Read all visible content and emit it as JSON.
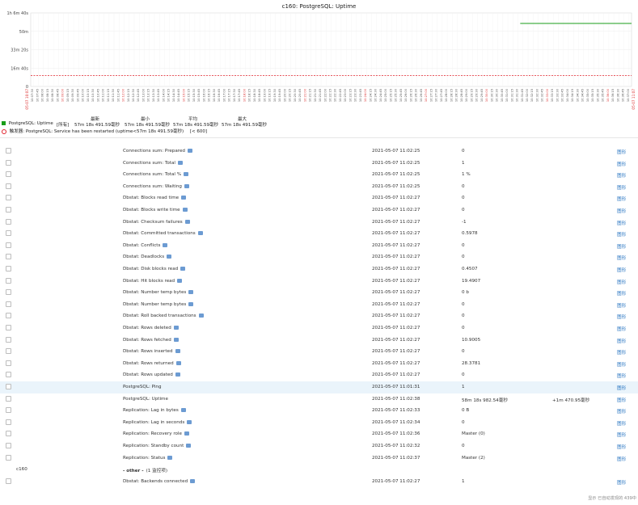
{
  "chart_data": {
    "type": "line",
    "title": "c160: PostgreSQL: Uptime",
    "y_ticks": [
      "1h 6m 40s",
      "50m",
      "33m 20s",
      "16m 40s",
      "0"
    ],
    "x_ticks": [
      "10:07:30",
      "10:07:45",
      "10:08:00",
      "10:08:15",
      "10:08:30",
      "10:08:45",
      "10:09:00",
      "10:09:15",
      "10:09:30",
      "10:09:45",
      "10:10:00",
      "10:10:15",
      "10:10:30",
      "10:10:45",
      "10:11:00",
      "10:11:15",
      "10:11:30",
      "10:11:45",
      "10:12:00",
      "10:12:15",
      "10:12:30",
      "10:12:45",
      "10:13:00",
      "10:13:15",
      "10:13:30",
      "10:13:45",
      "10:14:00",
      "10:14:15",
      "10:14:30",
      "10:14:45",
      "10:15:00",
      "10:15:15",
      "10:15:30",
      "10:15:45",
      "10:16:00",
      "10:16:15",
      "10:16:30",
      "10:16:45",
      "10:17:00",
      "10:17:15",
      "10:17:30",
      "10:17:45",
      "10:18:00",
      "10:18:15",
      "10:18:30",
      "10:18:45",
      "10:19:00",
      "10:19:15",
      "10:19:30",
      "10:19:45",
      "10:20:00",
      "10:20:15",
      "10:20:30",
      "10:20:45",
      "10:21:00",
      "10:21:15",
      "10:21:30",
      "10:21:45",
      "10:22:00",
      "10:22:15",
      "10:22:30",
      "10:22:45",
      "10:23:00",
      "10:23:15",
      "10:23:30",
      "10:23:45",
      "10:24:00",
      "10:24:15",
      "10:24:30",
      "10:24:45",
      "10:25:00",
      "10:25:15",
      "10:25:30",
      "10:25:45",
      "10:26:00",
      "10:26:15",
      "10:26:30",
      "10:26:45",
      "10:27:00",
      "10:27:15",
      "10:27:30",
      "10:27:45",
      "10:28:00",
      "10:28:15",
      "10:28:30",
      "10:28:45",
      "10:29:00",
      "10:29:15",
      "10:29:30",
      "10:29:45",
      "10:30:00",
      "10:30:15",
      "10:30:30",
      "10:30:45",
      "10:31:00",
      "10:31:15",
      "10:31:30",
      "10:31:45",
      "10:32:00",
      "10:32:15",
      "10:32:30",
      "10:32:45",
      "10:33:00",
      "10:33:15",
      "10:33:30",
      "10:33:45",
      "10:34:00",
      "10:34:15",
      "10:34:30",
      "10:34:45",
      "10:35:00",
      "10:35:15",
      "10:35:30",
      "10:35:45",
      "10:36:00",
      "10:36:15",
      "10:36:30",
      "10:36:45",
      "10:37:00"
    ],
    "x_start_label": "05-07 10:07",
    "x_end_label": "05-07 11:07",
    "series": [
      {
        "name": "PostgreSQL: Uptime",
        "color": "#1a9d1a",
        "x_start_frac": 0.8147,
        "x_end_frac": 1.0,
        "value_seconds": 3431
      }
    ],
    "trigger": {
      "value_seconds": 600,
      "color": "#e0202a"
    },
    "ylim_seconds": [
      0,
      4000
    ],
    "grid": true
  },
  "legend": {
    "headers": {
      "last": "最新",
      "min": "最小",
      "avg": "平均",
      "max": "最大"
    },
    "series_label": "PostgreSQL: Uptime",
    "series_scope": "[所有]",
    "last": "57m 18s 491.59毫秒",
    "min": "57m 18s 491.59毫秒",
    "avg": "57m 18s 491.59毫秒",
    "max": "57m 18s 491.59毫秒",
    "trigger_label": "触发器: PostgreSQL: Service has been restarted (uptime<57m 18s 491.59毫秒)",
    "trigger_cond": "[< 600]"
  },
  "rows": [
    {
      "name": "Connections sum: Prepared",
      "time": "2021-05-07 11:02:25",
      "value": "0",
      "change": "",
      "link": "图形",
      "flag": true,
      "highlight": false
    },
    {
      "name": "Connections sum: Total",
      "time": "2021-05-07 11:02:25",
      "value": "1",
      "change": "",
      "link": "图形",
      "flag": true,
      "highlight": false
    },
    {
      "name": "Connections sum: Total %",
      "time": "2021-05-07 11:02:25",
      "value": "1 %",
      "change": "",
      "link": "图形",
      "flag": true,
      "highlight": false
    },
    {
      "name": "Connections sum: Waiting",
      "time": "2021-05-07 11:02:25",
      "value": "0",
      "change": "",
      "link": "图形",
      "flag": true,
      "highlight": false
    },
    {
      "name": "Dbstat: Blocks read time",
      "time": "2021-05-07 11:02:27",
      "value": "0",
      "change": "",
      "link": "图形",
      "flag": true,
      "highlight": false
    },
    {
      "name": "Dbstat: Blocks write time",
      "time": "2021-05-07 11:02:27",
      "value": "0",
      "change": "",
      "link": "图形",
      "flag": true,
      "highlight": false
    },
    {
      "name": "Dbstat: Checksum failures",
      "time": "2021-05-07 11:02:27",
      "value": "-1",
      "change": "",
      "link": "图形",
      "flag": true,
      "highlight": false
    },
    {
      "name": "Dbstat: Committed transactions",
      "time": "2021-05-07 11:02:27",
      "value": "0.5978",
      "change": "",
      "link": "图形",
      "flag": true,
      "highlight": false
    },
    {
      "name": "Dbstat: Conflicts",
      "time": "2021-05-07 11:02:27",
      "value": "0",
      "change": "",
      "link": "图形",
      "flag": true,
      "highlight": false
    },
    {
      "name": "Dbstat: Deadlocks",
      "time": "2021-05-07 11:02:27",
      "value": "0",
      "change": "",
      "link": "图形",
      "flag": true,
      "highlight": false
    },
    {
      "name": "Dbstat: Disk blocks read",
      "time": "2021-05-07 11:02:27",
      "value": "0.4507",
      "change": "",
      "link": "图形",
      "flag": true,
      "highlight": false
    },
    {
      "name": "Dbstat: Hit blocks read",
      "time": "2021-05-07 11:02:27",
      "value": "19.4907",
      "change": "",
      "link": "图形",
      "flag": true,
      "highlight": false
    },
    {
      "name": "Dbstat: Number temp bytes",
      "time": "2021-05-07 11:02:27",
      "value": "0 b",
      "change": "",
      "link": "图形",
      "flag": true,
      "highlight": false
    },
    {
      "name": "Dbstat: Number temp bytes",
      "time": "2021-05-07 11:02:27",
      "value": "0",
      "change": "",
      "link": "图形",
      "flag": true,
      "highlight": false
    },
    {
      "name": "Dbstat: Roll backed transactions",
      "time": "2021-05-07 11:02:27",
      "value": "0",
      "change": "",
      "link": "图形",
      "flag": true,
      "highlight": false
    },
    {
      "name": "Dbstat: Rows deleted",
      "time": "2021-05-07 11:02:27",
      "value": "0",
      "change": "",
      "link": "图形",
      "flag": true,
      "highlight": false
    },
    {
      "name": "Dbstat: Rows fetched",
      "time": "2021-05-07 11:02:27",
      "value": "10.9005",
      "change": "",
      "link": "图形",
      "flag": true,
      "highlight": false
    },
    {
      "name": "Dbstat: Rows inserted",
      "time": "2021-05-07 11:02:27",
      "value": "0",
      "change": "",
      "link": "图形",
      "flag": true,
      "highlight": false
    },
    {
      "name": "Dbstat: Rows returned",
      "time": "2021-05-07 11:02:27",
      "value": "28.3781",
      "change": "",
      "link": "图形",
      "flag": true,
      "highlight": false
    },
    {
      "name": "Dbstat: Rows updated",
      "time": "2021-05-07 11:02:27",
      "value": "0",
      "change": "",
      "link": "图形",
      "flag": true,
      "highlight": false
    },
    {
      "name": "PostgreSQL: Ping",
      "time": "2021-05-07 11:01:31",
      "value": "1",
      "change": "",
      "link": "图形",
      "flag": false,
      "highlight": true
    },
    {
      "name": "PostgreSQL: Uptime",
      "time": "2021-05-07 11:02:38",
      "value": "58m 18s 982.54毫秒",
      "change": "+1m 470.95毫秒",
      "link": "图形",
      "flag": false,
      "highlight": false
    },
    {
      "name": "Replication: Lag in bytes",
      "time": "2021-05-07 11:02:33",
      "value": "0 B",
      "change": "",
      "link": "图形",
      "flag": true,
      "highlight": false
    },
    {
      "name": "Replication: Lag in seconds",
      "time": "2021-05-07 11:02:34",
      "value": "0",
      "change": "",
      "link": "图形",
      "flag": true,
      "highlight": false
    },
    {
      "name": "Replication: Recovery role",
      "time": "2021-05-07 11:02:36",
      "value": "Master (0)",
      "change": "",
      "link": "图形",
      "flag": true,
      "highlight": false
    },
    {
      "name": "Replication: Standby count",
      "time": "2021-05-07 11:02:32",
      "value": "0",
      "change": "",
      "link": "图形",
      "flag": true,
      "highlight": false
    },
    {
      "name": "Replication: Status",
      "time": "2021-05-07 11:02:37",
      "value": "Master (2)",
      "change": "",
      "link": "图形",
      "flag": true,
      "highlight": false
    }
  ],
  "group": {
    "host": "c160",
    "name": "- other -",
    "count": "(1 监控项)"
  },
  "last_row": {
    "name": "Dbstat: Backends connected",
    "time": "2021-05-07 11:02:27",
    "value": "1",
    "change": "",
    "link": "图形",
    "flag": true
  },
  "footer": "显示 已自动发现的 439中"
}
